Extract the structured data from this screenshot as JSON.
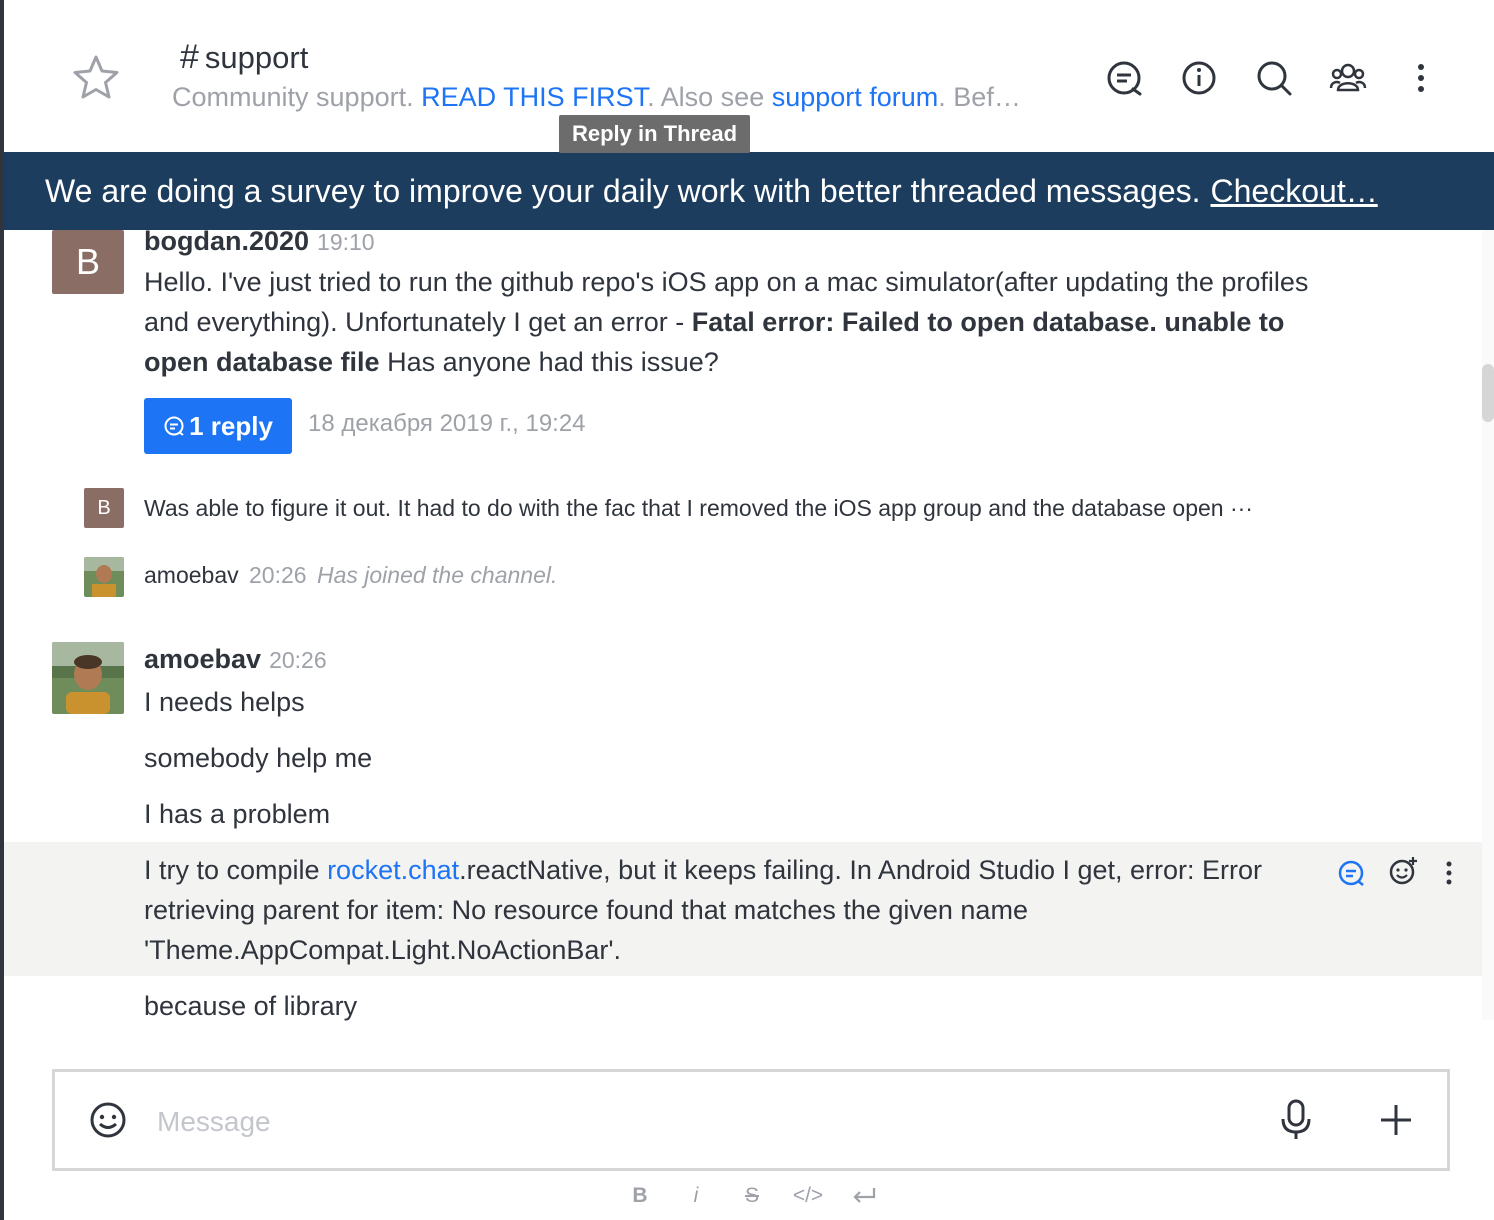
{
  "header": {
    "channel_name": "support",
    "topic": {
      "part1": "Community support. ",
      "link1": "READ THIS FIRST",
      "part2": ". Also see ",
      "link2": "support forum",
      "part3": ". Bef…"
    }
  },
  "tooltip": "Reply in Thread",
  "banner": {
    "text": "We are doing a survey to improve your daily work with better threaded messages.",
    "link": "Checkout…"
  },
  "messages": {
    "m1": {
      "avatar_letter": "B",
      "username": "bogdan.2020",
      "time": "19:10",
      "text_a": "Hello. I've just tried to run the github repo's iOS app on a mac simulator(after updating the profiles and everything). Unfortunately I get an error - ",
      "bold": "Fatal error: Failed to open database. unable to open database file",
      "text_b": " Has anyone had this issue?",
      "reply_label": "1 reply",
      "reply_date": "18 декабря 2019 г., 19:24"
    },
    "m2": {
      "avatar_letter": "B",
      "text": "Was able to figure it out. It had to do with the fac that I removed the iOS app group and the database open ···"
    },
    "m3": {
      "username": "amoebav",
      "time": "20:26",
      "system_text": "Has joined the channel."
    },
    "m4": {
      "username": "amoebav",
      "time": "20:26",
      "lines": [
        "I needs helps",
        "somebody help me",
        "I has a problem"
      ],
      "hover_a": "I try to compile ",
      "hover_link": "rocket.chat",
      "hover_b": ".reactNative, but it keeps failing. In Android Studio I get, error: Error retrieving parent for item: No resource found that matches the given name 'Theme.AppCompat.Light.NoActionBar'.",
      "last": "because of library"
    }
  },
  "composer": {
    "placeholder": "Message"
  },
  "format_toolbar": {
    "bold": "B",
    "italic": "i",
    "strike": "S",
    "code": "</>"
  },
  "colors": {
    "accent": "#1d74f5",
    "banner": "#1d3d5e",
    "avatar": "#8a6e65",
    "hover_bg": "#f3f3f2"
  }
}
